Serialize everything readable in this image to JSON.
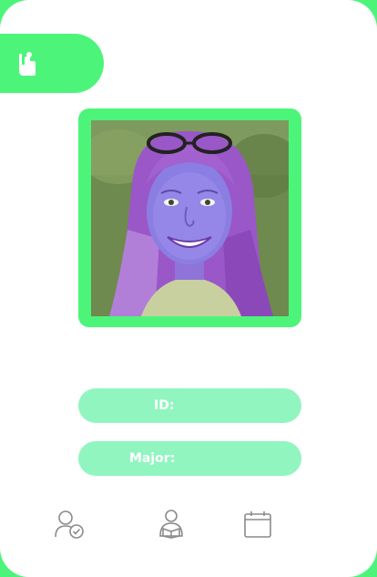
{
  "colors": {
    "accent": "#4cf57a",
    "pill": "#91f5c0",
    "card": "#ffffff",
    "icon_gray": "#8a8a8a"
  },
  "header": {
    "icon": "raised-hand-icon"
  },
  "profile": {
    "photo_icon": "student-portrait-photo"
  },
  "fields": {
    "id_label": "ID:",
    "id_value": "",
    "major_label": "Major:",
    "major_value": ""
  },
  "nav": {
    "items": [
      {
        "icon": "user-check-icon"
      },
      {
        "icon": "student-reading-icon"
      },
      {
        "icon": "calendar-icon"
      }
    ]
  }
}
